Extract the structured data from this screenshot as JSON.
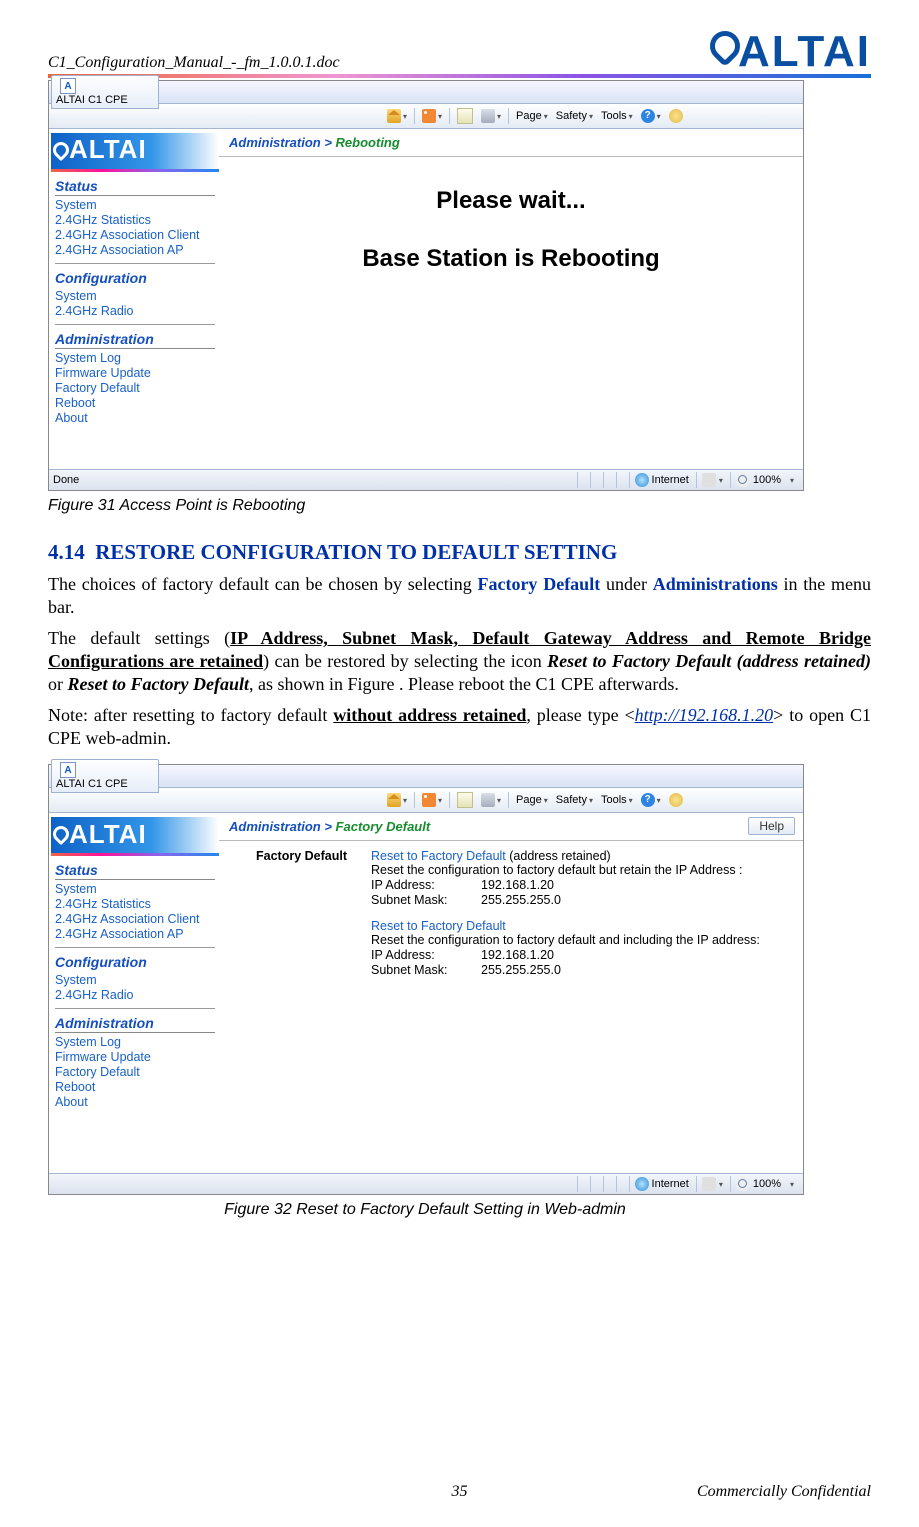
{
  "doc": {
    "filename": "C1_Configuration_Manual_-_fm_1.0.0.1.doc",
    "brand": "ALTAI",
    "page_number": "35",
    "confidential": "Commercially Confidential"
  },
  "shot": {
    "tab_title": "ALTAI C1 CPE",
    "toolbar": {
      "page": "Page",
      "safety": "Safety",
      "tools": "Tools"
    },
    "sidebar": {
      "logo": "ALTAI",
      "cats": {
        "status": "Status",
        "config": "Configuration",
        "admin": "Administration"
      },
      "status_links": [
        "System",
        "2.4GHz Statistics",
        "2.4GHz Association Client",
        "2.4GHz Association AP"
      ],
      "config_links": [
        "System",
        "2.4GHz Radio"
      ],
      "admin_links": [
        "System Log",
        "Firmware Update",
        "Factory Default",
        "Reboot",
        "About"
      ]
    },
    "crumb1": {
      "a": "Administration > ",
      "b": "Rebooting"
    },
    "msg1": "Please wait...",
    "msg2": "Base Station is Rebooting",
    "status": {
      "done": "Done",
      "inet": "Internet",
      "zoom": "100%"
    }
  },
  "shot2": {
    "crumb": {
      "a": "Administration > ",
      "b": "Factory Default"
    },
    "help": "Help",
    "fd_label": "Factory Default",
    "block1": {
      "link": "Reset to Factory Default",
      "extra": " (address retained)",
      "desc": "Reset the configuration to factory default but retain the IP Address :",
      "ip_l": "IP Address:",
      "ip_v": "192.168.1.20",
      "sm_l": "Subnet Mask:",
      "sm_v": "255.255.255.0"
    },
    "block2": {
      "link": "Reset to Factory Default",
      "desc": "Reset the configuration to factory default and including the IP address:",
      "ip_l": "IP Address:",
      "ip_v": "192.168.1.20",
      "sm_l": "Subnet Mask:",
      "sm_v": "255.255.255.0"
    },
    "status": {
      "inet": "Internet",
      "zoom": "100%"
    }
  },
  "captions": {
    "fig31": "Figure 31    Access Point is Rebooting",
    "fig32": "Figure 32    Reset to Factory Default Setting in Web-admin"
  },
  "section": {
    "num": "4.14",
    "title": "RESTORE CONFIGURATION TO DEFAULT SETTING",
    "p1_a": "The choices of factory default can be chosen by selecting ",
    "p1_b": "Factory Default",
    "p1_c": " under ",
    "p1_d": "Administrations",
    "p1_e": " in the menu bar.",
    "p2_a": "The default settings (",
    "p2_b": "IP Address, Subnet Mask, Default Gateway Address and Remote Bridge Configurations are retained",
    "p2_c": ") can be restored by selecting the icon ",
    "p2_d": "Reset to Factory Default (address retained)",
    "p2_e": " or ",
    "p2_f": "Reset to Factory Default",
    "p2_g": ", as shown in Figure . Please reboot the C1 CPE afterwards.",
    "p3_a": "Note: after resetting to factory default ",
    "p3_b": "without address retained",
    "p3_c": ", please type <",
    "p3_d": "http://192.168.1.20",
    "p3_e": "> to open C1 CPE web-admin."
  }
}
